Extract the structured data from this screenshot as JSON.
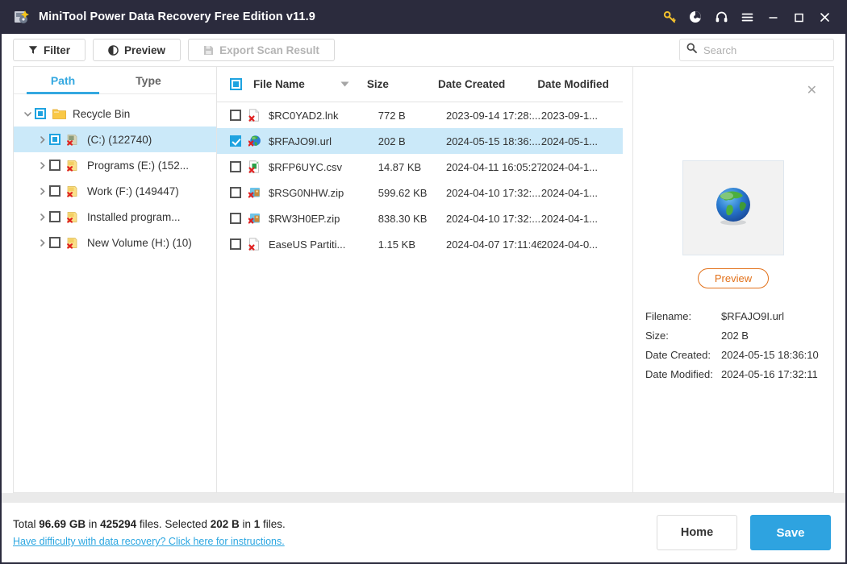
{
  "window": {
    "title": "MiniTool Power Data Recovery Free Edition v11.9",
    "icon": "app-disk-icon",
    "titlebar_bg": "#2b2b3d",
    "controls": [
      {
        "name": "key-icon",
        "glyph": "key"
      },
      {
        "name": "disc-icon",
        "glyph": "disc"
      },
      {
        "name": "headset-icon",
        "glyph": "headset"
      },
      {
        "name": "menu-icon",
        "glyph": "menu"
      },
      {
        "name": "minimize-icon",
        "glyph": "minimize"
      },
      {
        "name": "maximize-icon",
        "glyph": "maximize"
      },
      {
        "name": "close-icon",
        "glyph": "close"
      }
    ]
  },
  "toolbar": {
    "filter_label": "Filter",
    "preview_label": "Preview",
    "export_label": "Export Scan Result",
    "export_disabled": true
  },
  "search": {
    "placeholder": "Search",
    "value": ""
  },
  "sidebar": {
    "tabs": [
      {
        "label": "Path",
        "active": true
      },
      {
        "label": "Type",
        "active": false
      }
    ],
    "tree": [
      {
        "label": "Recycle Bin",
        "level": 0,
        "expanded": true,
        "check": "partial",
        "icon": "folder-icon",
        "selected": false
      },
      {
        "label": "(C:) (122740)",
        "level": 1,
        "expanded": false,
        "check": "partial",
        "icon": "drive-deleted-icon",
        "selected": true
      },
      {
        "label": "Programs (E:) (152...",
        "level": 1,
        "expanded": false,
        "check": "none",
        "icon": "drive-deleted-icon",
        "selected": false
      },
      {
        "label": "Work (F:) (149447)",
        "level": 1,
        "expanded": false,
        "check": "none",
        "icon": "drive-deleted-icon",
        "selected": false
      },
      {
        "label": "Installed program...",
        "level": 1,
        "expanded": false,
        "check": "none",
        "icon": "drive-deleted-icon",
        "selected": false
      },
      {
        "label": "New Volume (H:) (10)",
        "level": 1,
        "expanded": false,
        "check": "none",
        "icon": "drive-deleted-icon",
        "selected": false
      }
    ]
  },
  "filelist": {
    "columns": {
      "name": "File Name",
      "size": "Size",
      "created": "Date Created",
      "modified": "Date Modified"
    },
    "sort_indicator": "descending",
    "header_checkbox": "partial",
    "rows": [
      {
        "name": "$RC0YAD2.lnk",
        "size": "772 B",
        "created": "2023-09-14 17:28:...",
        "modified": "2023-09-1...",
        "icon": "file-deleted-icon",
        "checked": false,
        "selected": false
      },
      {
        "name": "$RFAJO9I.url",
        "size": "202 B",
        "created": "2024-05-15 18:36:...",
        "modified": "2024-05-1...",
        "icon": "url-globe-icon",
        "checked": true,
        "selected": true
      },
      {
        "name": "$RFP6UYC.csv",
        "size": "14.87 KB",
        "created": "2024-04-11 16:05:27",
        "modified": "2024-04-1...",
        "icon": "csv-deleted-icon",
        "checked": false,
        "selected": false
      },
      {
        "name": "$RSG0NHW.zip",
        "size": "599.62 KB",
        "created": "2024-04-10 17:32:...",
        "modified": "2024-04-1...",
        "icon": "zip-deleted-icon",
        "checked": false,
        "selected": false
      },
      {
        "name": "$RW3H0EP.zip",
        "size": "838.30 KB",
        "created": "2024-04-10 17:32:...",
        "modified": "2024-04-1...",
        "icon": "zip-deleted-icon",
        "checked": false,
        "selected": false
      },
      {
        "name": "EaseUS Partiti...",
        "size": "1.15 KB",
        "created": "2024-04-07 17:11:46",
        "modified": "2024-04-0...",
        "icon": "file-deleted-icon",
        "checked": false,
        "selected": false
      }
    ]
  },
  "preview": {
    "close_glyph": "✕",
    "thumbnail_icon": "globe-icon",
    "button_label": "Preview",
    "button_color": "#e2711a",
    "fields": [
      {
        "key": "Filename:",
        "value": "$RFAJO9I.url"
      },
      {
        "key": "Size:",
        "value": "202 B"
      },
      {
        "key": "Date Created:",
        "value": "2024-05-15 18:36:10"
      },
      {
        "key": "Date Modified:",
        "value": "2024-05-16 17:32:11"
      }
    ]
  },
  "footer": {
    "status_prefix": "Total ",
    "total_size": "96.69 GB",
    "status_mid1": " in ",
    "total_files": "425294",
    "status_mid2": " files.  Selected ",
    "selected_size": "202 B",
    "status_mid3": " in ",
    "selected_files": "1",
    "status_suffix": " files.",
    "help_link": "Have difficulty with data recovery? Click here for instructions.",
    "home_label": "Home",
    "save_label": "Save",
    "save_color": "#2ea3e0"
  }
}
